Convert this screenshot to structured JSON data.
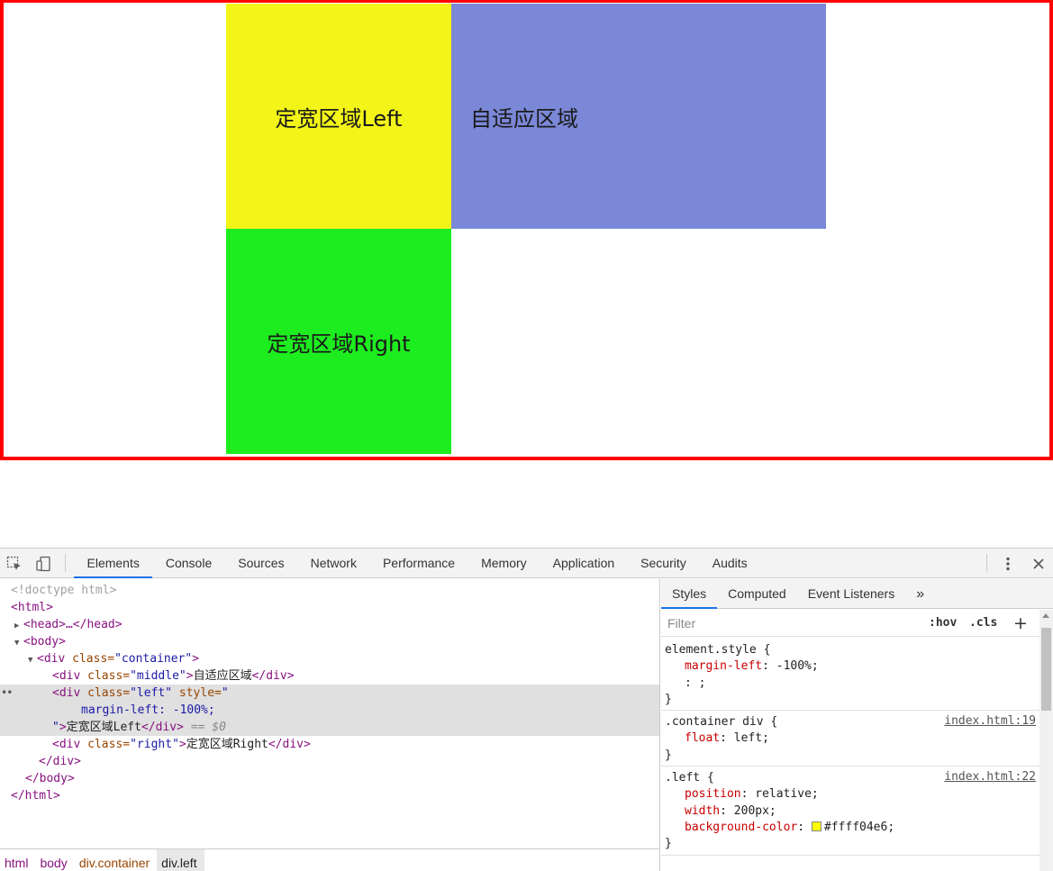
{
  "page": {
    "blocks": {
      "left": {
        "text": "定宽区域Left",
        "color": "#f3f518"
      },
      "middle": {
        "text": "自适应区域",
        "color": "#7b88d8"
      },
      "right": {
        "text": "定宽区域Right",
        "color": "#1ded1f"
      }
    },
    "border_color": "#ff0000"
  },
  "devtools": {
    "tabs": [
      "Elements",
      "Console",
      "Sources",
      "Network",
      "Performance",
      "Memory",
      "Application",
      "Security",
      "Audits"
    ],
    "active_tab": "Elements",
    "dom": {
      "doctype": "<!doctype html>",
      "html_open": "<html>",
      "head": "<head>…</head>",
      "body_open": "<body>",
      "container_tag": "<div",
      "class_attr": " class=",
      "container_val": "\"container\"",
      "middle_val": "\"middle\"",
      "middle_text": "自适应区域",
      "left_val": "\"left\"",
      "style_attr": " style=",
      "style_open": "\"",
      "style_body": "margin-left: -100%;",
      "style_close": "\"",
      "left_text": "定宽区域Left",
      "div_close": "</div>",
      "eq": " == ",
      "dollar": "$0",
      "right_val": "\"right\"",
      "right_text": "定宽区域Right",
      "body_close": "</body>",
      "html_close": "</html>",
      "gt": ">"
    },
    "breadcrumbs": [
      "html",
      "body",
      "div.container",
      "div.left"
    ],
    "sidebar": {
      "tabs": [
        "Styles",
        "Computed",
        "Event Listeners"
      ],
      "more": "»",
      "filter_placeholder": "Filter",
      "hov": ":hov",
      "cls": ".cls",
      "plus": "+"
    },
    "rules": {
      "element_style": {
        "selector": "element.style {",
        "p1_name": "margin-left",
        "p1_value": ": -100%;",
        "p2": ": ;"
      },
      "container_div": {
        "selector": ".container div {",
        "source": "index.html:19",
        "p1_name": "float",
        "p1_value": ": left;"
      },
      "left": {
        "selector": ".left {",
        "source": "index.html:22",
        "p1_name": "position",
        "p1_value": ": relative;",
        "p2_name": "width",
        "p2_value": ": 200px;",
        "p3_name": "background-color",
        "p3_sep": ": ",
        "p3_value": "#ffff04e6;",
        "swatch_color": "#ffff04"
      },
      "close_brace": "}"
    }
  }
}
